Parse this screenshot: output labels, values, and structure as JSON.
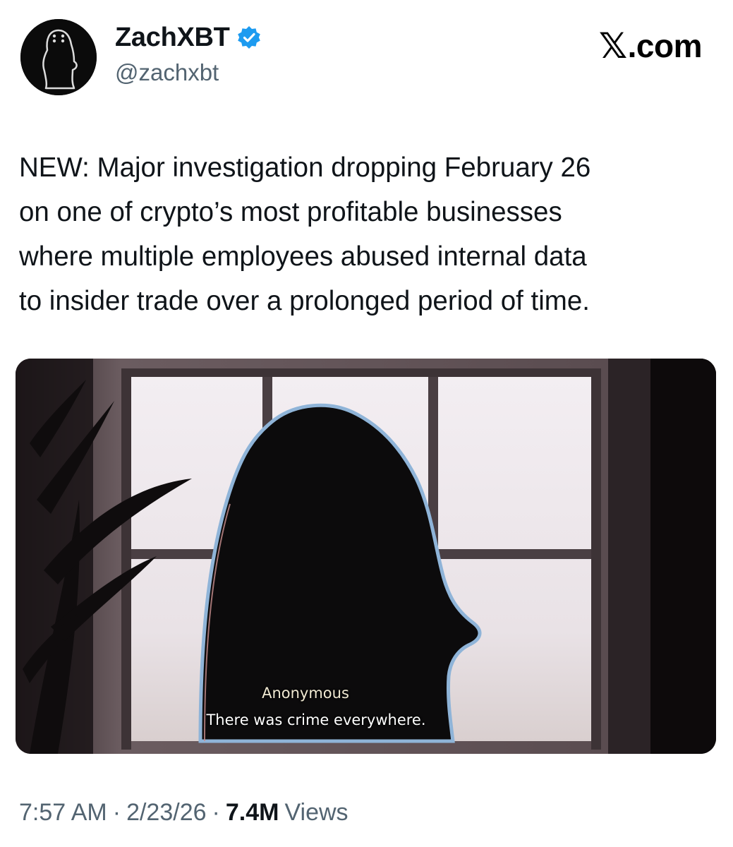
{
  "author": {
    "display_name": "ZachXBT",
    "handle": "@zachxbt",
    "verified": true,
    "avatar_icon": "penguin-silhouette-icon",
    "verified_icon": "verified-badge-icon",
    "badge_color": "#1d9bf0"
  },
  "brand": {
    "x_glyph": "𝕏",
    "domain": ".com",
    "icon": "x-logo-icon"
  },
  "tweet": {
    "lines": [
      "NEW: Major investigation dropping February 26",
      "on one of crypto’s most profitable businesses",
      "where multiple employees abused internal data",
      "to insider trade over a prolonged period of time."
    ]
  },
  "media": {
    "description_icon": "silhouette-image",
    "caption_speaker": "Anonymous",
    "caption_text": "There was crime everywhere."
  },
  "meta": {
    "time": "7:57 AM",
    "separator": "·",
    "date": "2/23/26",
    "views_count": "7.4M",
    "views_label": "Views"
  },
  "colors": {
    "text_primary": "#0f1419",
    "text_secondary": "#536471",
    "accent": "#1d9bf0"
  }
}
